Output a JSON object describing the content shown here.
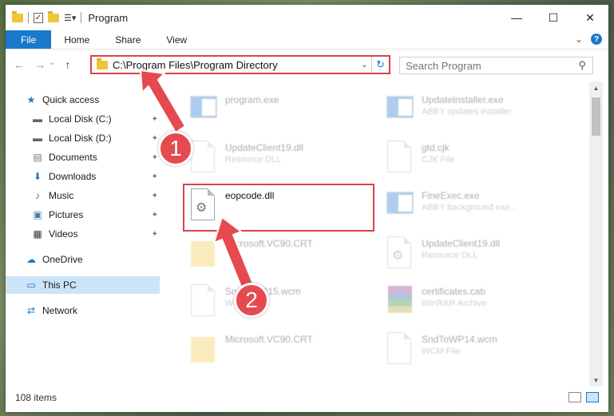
{
  "window": {
    "title": "Program",
    "controls": {
      "minimize": "—",
      "maximize": "☐",
      "close": "✕"
    }
  },
  "ribbon": {
    "tabs": [
      "File",
      "Home",
      "Share",
      "View"
    ],
    "expand": "⌄",
    "help": "?"
  },
  "address": {
    "path": "C:\\Program Files\\Program Directory",
    "dropdown": "⌄",
    "refresh": "↻"
  },
  "search": {
    "placeholder": "Search Program",
    "icon": "⚲"
  },
  "nav": {
    "back": "←",
    "forward": "→",
    "recent": "⌄",
    "up": "↑"
  },
  "sidebar": {
    "items": [
      {
        "label": "Quick access",
        "icon": "★",
        "pinned": false
      },
      {
        "label": "Local Disk (C:)",
        "icon": "▬",
        "pinned": true
      },
      {
        "label": "Local Disk (D:)",
        "icon": "▬",
        "pinned": true
      },
      {
        "label": "Documents",
        "icon": "▤",
        "pinned": true
      },
      {
        "label": "Downloads",
        "icon": "⬇",
        "pinned": true
      },
      {
        "label": "Music",
        "icon": "♪",
        "pinned": true
      },
      {
        "label": "Pictures",
        "icon": "▣",
        "pinned": true
      },
      {
        "label": "Videos",
        "icon": "▦",
        "pinned": true
      },
      {
        "label": "OneDrive",
        "icon": "☁",
        "pinned": false
      },
      {
        "label": "This PC",
        "icon": "▭",
        "pinned": false
      },
      {
        "label": "Network",
        "icon": "⇄",
        "pinned": false
      }
    ],
    "pin_glyph": "📌"
  },
  "files": [
    {
      "name": "program.exe",
      "desc": "",
      "icon": "app"
    },
    {
      "name": "UpdateInstaller.exe",
      "desc": "ABBY updates installer",
      "icon": "app"
    },
    {
      "name": "UpdateClient19.dll",
      "desc": "Resource DLL",
      "icon": "doc"
    },
    {
      "name": "gtd.cjk",
      "desc": "CJK File",
      "icon": "doc"
    },
    {
      "name": "eopcode.dll",
      "desc": "",
      "icon": "dll"
    },
    {
      "name": "FineExec.exe",
      "desc": "ABBY background exe...",
      "icon": "app"
    },
    {
      "name": "Microsoft.VC90.CRT",
      "desc": "",
      "icon": "folder"
    },
    {
      "name": "UpdateClient19.dll",
      "desc": "Resource DLL",
      "icon": "dll"
    },
    {
      "name": "SndToWP15.wcm",
      "desc": "WCM File",
      "icon": "doc"
    },
    {
      "name": "certificates.cab",
      "desc": "WinRAR Archive",
      "icon": "rar"
    },
    {
      "name": "Microsoft.VC90.CRT",
      "desc": "",
      "icon": "folder"
    },
    {
      "name": "SndToWP14.wcm",
      "desc": "WCM File",
      "icon": "doc"
    }
  ],
  "status": {
    "count": "108 items"
  },
  "scroll": {
    "up": "▲",
    "down": "▼"
  },
  "annotations": {
    "step1": "1",
    "step2": "2"
  },
  "colors": {
    "accent": "#1979ca",
    "highlight": "#d9434a",
    "annotation": "#e44a50"
  }
}
